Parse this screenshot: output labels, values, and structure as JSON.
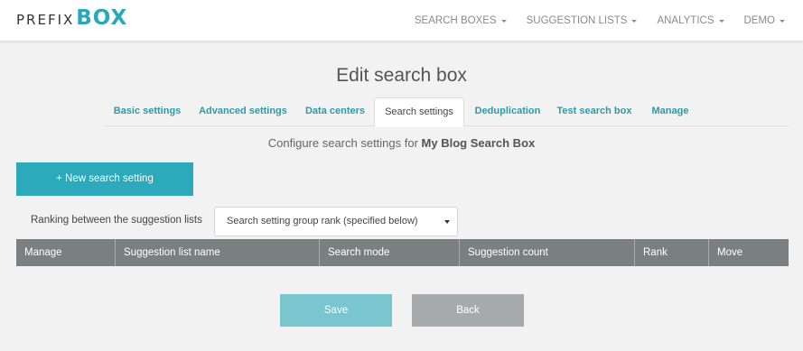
{
  "brand": {
    "prefix": "PREFIX",
    "box": "BOX"
  },
  "nav": {
    "items": [
      {
        "label": "SEARCH BOXES",
        "icon": "caret-down-icon"
      },
      {
        "label": "SUGGESTION LISTS",
        "icon": "caret-down-icon"
      },
      {
        "label": "ANALYTICS",
        "icon": "caret-down-icon"
      },
      {
        "label": "DEMO",
        "icon": "caret-down-icon"
      }
    ]
  },
  "page": {
    "title": "Edit search box",
    "configure_prefix": "Configure search settings for ",
    "search_box_name": "My Blog Search Box"
  },
  "tabs": [
    {
      "label": "Basic settings"
    },
    {
      "label": "Advanced settings"
    },
    {
      "label": "Data centers"
    },
    {
      "label": "Search settings",
      "active": true
    },
    {
      "label": "Deduplication"
    },
    {
      "label": "Test search box"
    },
    {
      "label": "Manage"
    }
  ],
  "actions": {
    "new_search_setting": "+ New search setting"
  },
  "ranking": {
    "label": "Ranking between the suggestion lists",
    "selected": "Search setting group rank (specified below)"
  },
  "table": {
    "columns": [
      "Manage",
      "Suggestion list name",
      "Search mode",
      "Suggestion count",
      "Rank",
      "Move"
    ]
  },
  "footer": {
    "save": "Save",
    "back": "Back"
  },
  "colors": {
    "accent": "#2ca9ba",
    "tab_link": "#2d9aa8",
    "table_header": "#7a8080",
    "save_button": "#79c6d0",
    "back_button": "#a6aaaa"
  }
}
